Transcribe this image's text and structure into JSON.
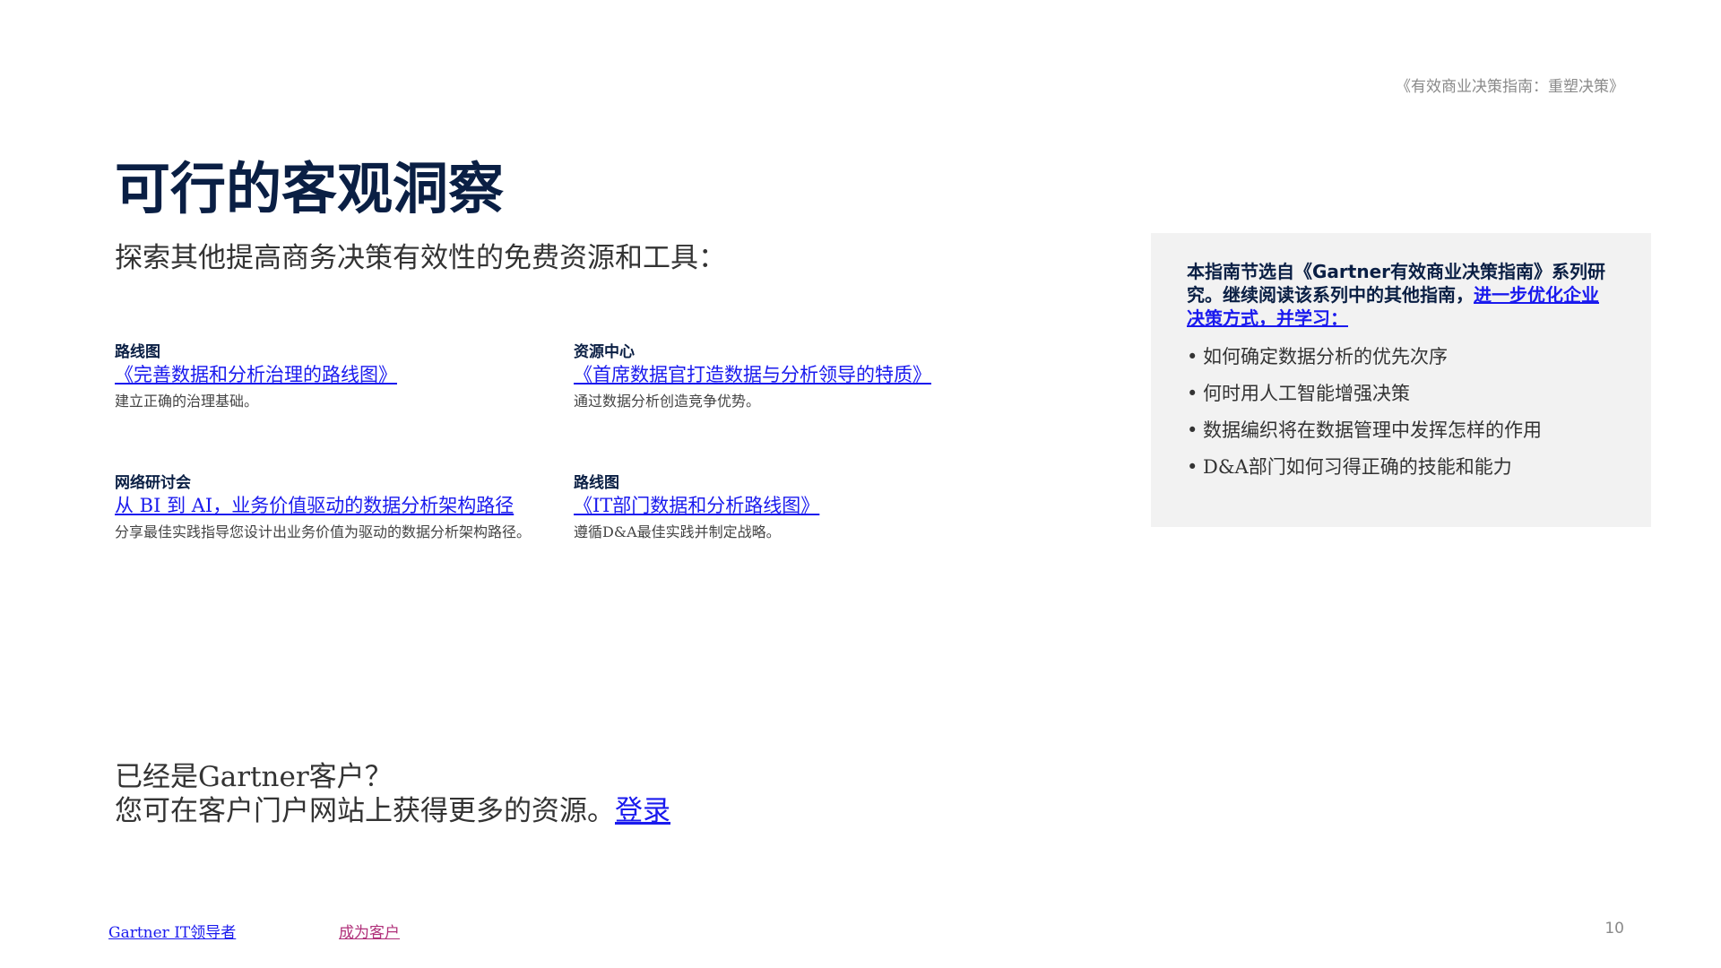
{
  "header": {
    "doc_title": "《有效商业决策指南：重塑决策》"
  },
  "page": {
    "title": "可行的客观洞察",
    "subtitle": "探索其他提高商务决策有效性的免费资源和工具："
  },
  "resources": [
    {
      "type": "路线图",
      "title": "《完善数据和分析治理的路线图》",
      "desc": "建立正确的治理基础。"
    },
    {
      "type": "资源中心",
      "title": "《首席数据官打造数据与分析领导的特质》",
      "desc": "通过数据分析创造竞争优势。"
    },
    {
      "type": "网络研讨会",
      "title": "从 BI 到 AI，业务价值驱动的数据分析架构路径",
      "desc": "分享最佳实践指导您设计出业务价值为驱动的数据分析架构路径。"
    },
    {
      "type": "路线图",
      "title": "《IT部门数据和分析路线图》",
      "desc": "遵循D&A最佳实践并制定战略。"
    }
  ],
  "cta": {
    "line1": "已经是Gartner客户？",
    "line2": "您可在客户门户网站上获得更多的资源。",
    "login_label": "登录"
  },
  "sidebar": {
    "intro_text": "本指南节选自《Gartner有效商业决策指南》系列研究。继续阅读该系列中的其他指南，",
    "intro_link": "进一步优化企业决策方式，并学习：",
    "items": [
      "如何确定数据分析的优先次序",
      "何时用人工智能增强决策",
      "数据编织将在数据管理中发挥怎样的作用",
      "D&A部门如何习得正确的技能和能力"
    ]
  },
  "footer": {
    "link_leaders": "Gartner IT领导者",
    "link_customer": "成为客户",
    "page_number": "10"
  }
}
